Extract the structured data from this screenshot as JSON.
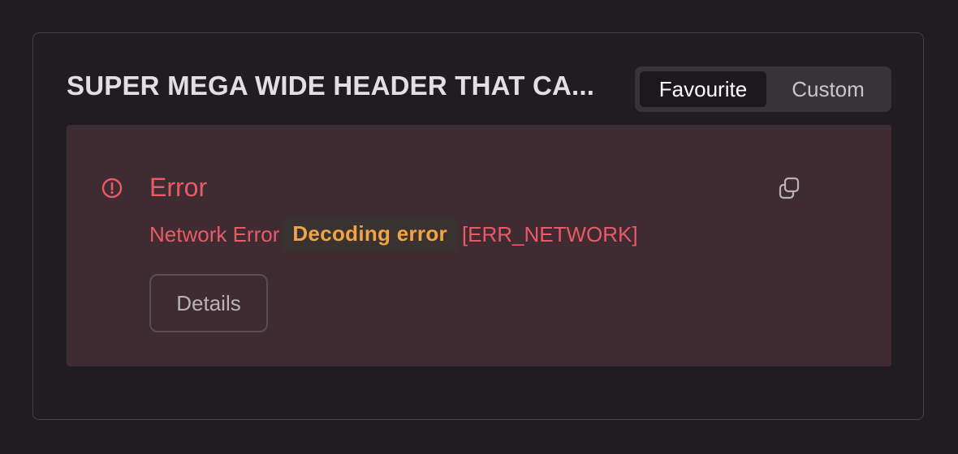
{
  "card": {
    "title": "SUPER MEGA WIDE HEADER THAT CA..."
  },
  "segmented": {
    "options": [
      {
        "label": "Favourite",
        "selected": true
      },
      {
        "label": "Custom",
        "selected": false
      }
    ]
  },
  "alert": {
    "icon": "alert-circle-icon",
    "title": "Error",
    "message": "Network Error",
    "code": "Decoding error",
    "error_code": "[ERR_NETWORK]",
    "copy_icon": "copy-icon",
    "details_label": "Details"
  },
  "colors": {
    "background": "#201d21",
    "alert_background": "#3e2c32",
    "error_text": "#ea5a66",
    "code_text": "#f1a444"
  }
}
